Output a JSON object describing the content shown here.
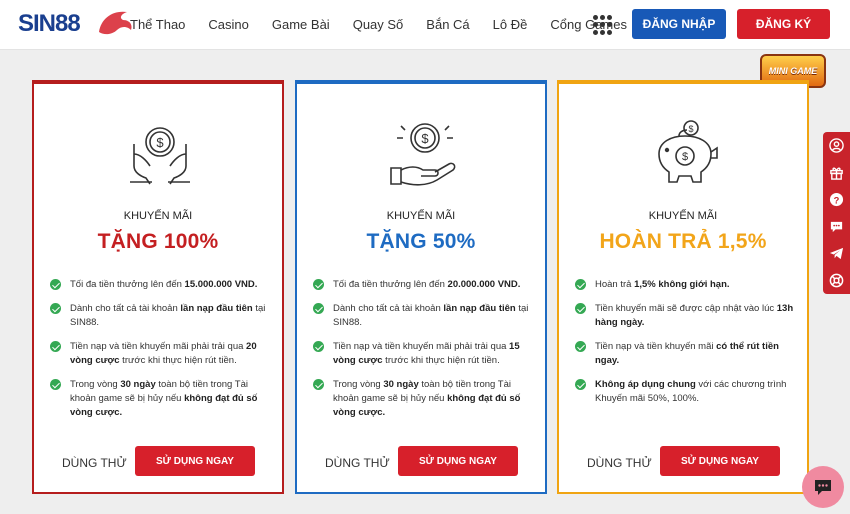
{
  "header": {
    "logo": "SIN88",
    "nav": [
      "Thể Thao",
      "Casino",
      "Game Bài",
      "Quay Số",
      "Bắn Cá",
      "Lô Đề",
      "Cổng Games"
    ],
    "login_label": "ĐĂNG NHẬP",
    "register_label": "ĐĂNG KÝ",
    "colors": {
      "login": "#1859b7",
      "register": "#d7202b"
    }
  },
  "mini_game": "MINI GAME",
  "cards": [
    {
      "kicker": "KHUYẾN MÃI",
      "title": "TẶNG 100%",
      "accent": "#c41f21",
      "icon": "hands-coin-icon",
      "items": [
        [
          [
            "Tối đa tiền thưởng lên đến ",
            false
          ],
          [
            "15.000.000 VND.",
            true
          ]
        ],
        [
          [
            "Dành cho tất cả tài khoản ",
            false
          ],
          [
            "lần nạp đầu tiên",
            true
          ],
          [
            " tại SIN88.",
            false
          ]
        ],
        [
          [
            "Tiền nạp và tiền khuyến mãi phải trải qua ",
            false
          ],
          [
            "20 vòng cược",
            true
          ],
          [
            " trước khi thực hiện rút tiền.",
            false
          ]
        ],
        [
          [
            "Trong vòng ",
            false
          ],
          [
            "30 ngày",
            true
          ],
          [
            " toàn bộ tiền trong Tài khoản game sẽ bị hủy nếu ",
            false
          ],
          [
            "không đạt đủ số vòng cược.",
            true
          ]
        ]
      ],
      "try_label": "DÙNG THỬ",
      "use_label": "SỬ DỤNG NGAY"
    },
    {
      "kicker": "KHUYẾN MÃI",
      "title": "TẶNG 50%",
      "accent": "#1e6bc2",
      "icon": "hand-coin-icon",
      "items": [
        [
          [
            "Tối đa tiền thưởng lên đến ",
            false
          ],
          [
            "20.000.000 VND.",
            true
          ]
        ],
        [
          [
            "Dành cho tất cả tài khoản ",
            false
          ],
          [
            "lần nạp đầu tiên",
            true
          ],
          [
            " tại SIN88.",
            false
          ]
        ],
        [
          [
            "Tiền nạp và tiền khuyến mãi phải trải qua ",
            false
          ],
          [
            "15 vòng cược",
            true
          ],
          [
            " trước khi thực hiện rút tiền.",
            false
          ]
        ],
        [
          [
            "Trong vòng ",
            false
          ],
          [
            "30 ngày",
            true
          ],
          [
            " toàn bộ tiền trong Tài khoản game sẽ bị hủy nếu ",
            false
          ],
          [
            "không đạt đủ số vòng cược.",
            true
          ]
        ]
      ],
      "try_label": "DÙNG THỬ",
      "use_label": "SỬ DỤNG NGAY"
    },
    {
      "kicker": "KHUYẾN MÃI",
      "title": "HOÀN TRẢ 1,5%",
      "accent": "#f2a51a",
      "icon": "piggy-bank-icon",
      "items": [
        [
          [
            "Hoàn trả ",
            false
          ],
          [
            "1,5% không giới hạn.",
            true
          ]
        ],
        [
          [
            "Tiền khuyến mãi sẽ được cập nhật vào lúc ",
            false
          ],
          [
            "13h hàng ngày.",
            true
          ]
        ],
        [
          [
            "Tiền nạp và tiền khuyến mãi ",
            false
          ],
          [
            "có thể rút tiền ngay.",
            true
          ]
        ],
        [
          [
            "Không áp dụng chung",
            true
          ],
          [
            " với các chương trình Khuyến mãi 50%, 100%.",
            false
          ]
        ]
      ],
      "try_label": "DÙNG THỬ",
      "use_label": "SỬ DỤNG NGAY"
    }
  ],
  "sidebar_icons": [
    "user-icon",
    "gift-icon",
    "help-icon",
    "chat-bubble-icon",
    "telegram-icon",
    "support-icon"
  ],
  "chat_icon": "chat-icon"
}
